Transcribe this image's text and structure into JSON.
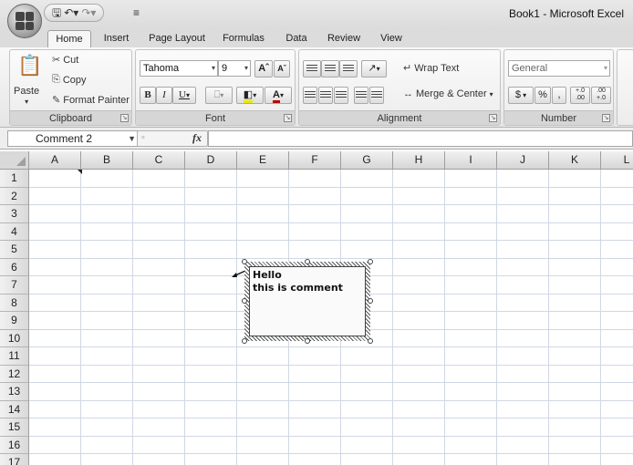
{
  "titlebar": {
    "title": "Book1 - Microsoft Excel",
    "qat_more": "≡"
  },
  "tabs": [
    "Home",
    "Insert",
    "Page Layout",
    "Formulas",
    "Data",
    "Review",
    "View"
  ],
  "clipboard": {
    "label": "Clipboard",
    "paste": "Paste",
    "cut": "Cut",
    "copy": "Copy",
    "format_painter": "Format Painter"
  },
  "font": {
    "label": "Font",
    "name": "Tahoma",
    "size": "9",
    "bold": "B",
    "italic": "I",
    "underline": "U"
  },
  "alignment": {
    "label": "Alignment",
    "wrap_text": "Wrap Text",
    "merge_center": "Merge & Center"
  },
  "number": {
    "label": "Number",
    "format": "General",
    "currency": "$",
    "percent": "%",
    "comma": ",",
    "inc_decimal": "+.0 .00",
    "dec_decimal": ".00 +.0"
  },
  "formula_bar": {
    "name_box": "Comment 2",
    "fx": "fx",
    "value": ""
  },
  "columns": [
    "A",
    "B",
    "C",
    "D",
    "E",
    "F",
    "G",
    "H",
    "I",
    "J",
    "K",
    "L"
  ],
  "rows": [
    "1",
    "2",
    "3",
    "4",
    "5",
    "6",
    "7",
    "8",
    "9",
    "10",
    "11",
    "12",
    "13",
    "14",
    "15",
    "16",
    "17"
  ],
  "comment": {
    "line1": "Hello",
    "line2": "this is comment"
  }
}
